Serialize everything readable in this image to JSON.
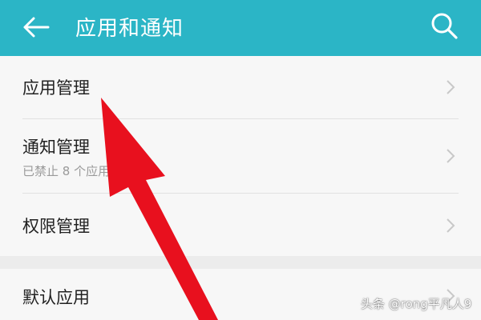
{
  "colors": {
    "appbar": "#2bb5c6",
    "arrow": "#e8101e",
    "text": "#222222",
    "subtext": "#9a9a9a"
  },
  "appbar": {
    "title": "应用和通知",
    "back_icon": "arrow-left-icon",
    "search_icon": "search-icon"
  },
  "items": [
    {
      "label": "应用管理",
      "sub": ""
    },
    {
      "label": "通知管理",
      "sub": "已禁止 8 个应用发送通知"
    },
    {
      "label": "权限管理",
      "sub": ""
    },
    {
      "label": "默认应用",
      "sub": ""
    }
  ],
  "watermark": "头条 @rong平凡人9"
}
